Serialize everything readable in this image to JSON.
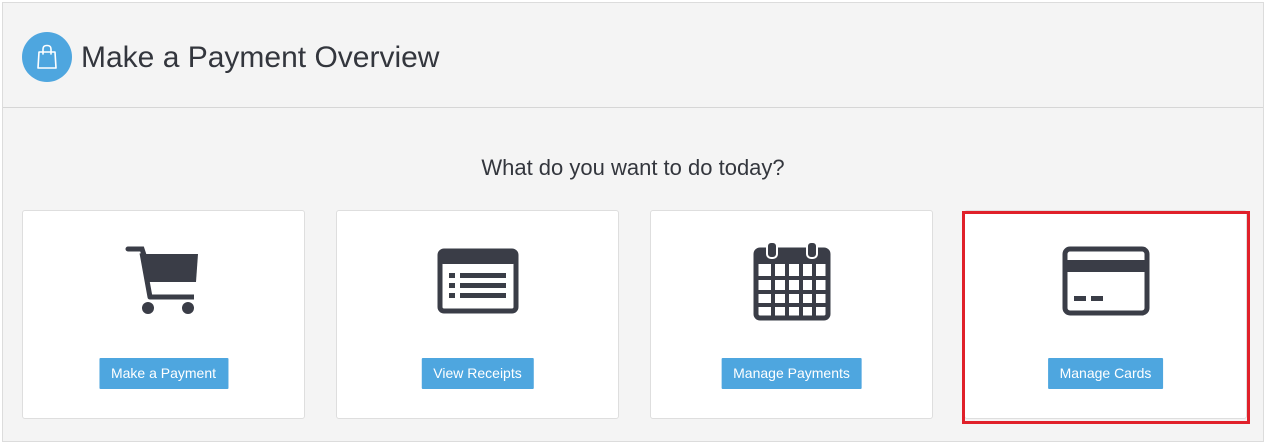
{
  "header": {
    "title": "Make a Payment Overview",
    "icon": "shopping-bag-icon",
    "icon_bg": "#4ea6df"
  },
  "prompt": "What do you want to do today?",
  "cards": [
    {
      "label": "Make a Payment",
      "icon": "shopping-cart-icon"
    },
    {
      "label": "View Receipts",
      "icon": "receipt-list-icon"
    },
    {
      "label": "Manage Payments",
      "icon": "calendar-icon"
    },
    {
      "label": "Manage Cards",
      "icon": "credit-card-icon",
      "highlighted": true
    }
  ],
  "colors": {
    "accent": "#4ea6df",
    "icon": "#3a3d47",
    "highlight": "#e0202a",
    "text": "#33363d"
  }
}
